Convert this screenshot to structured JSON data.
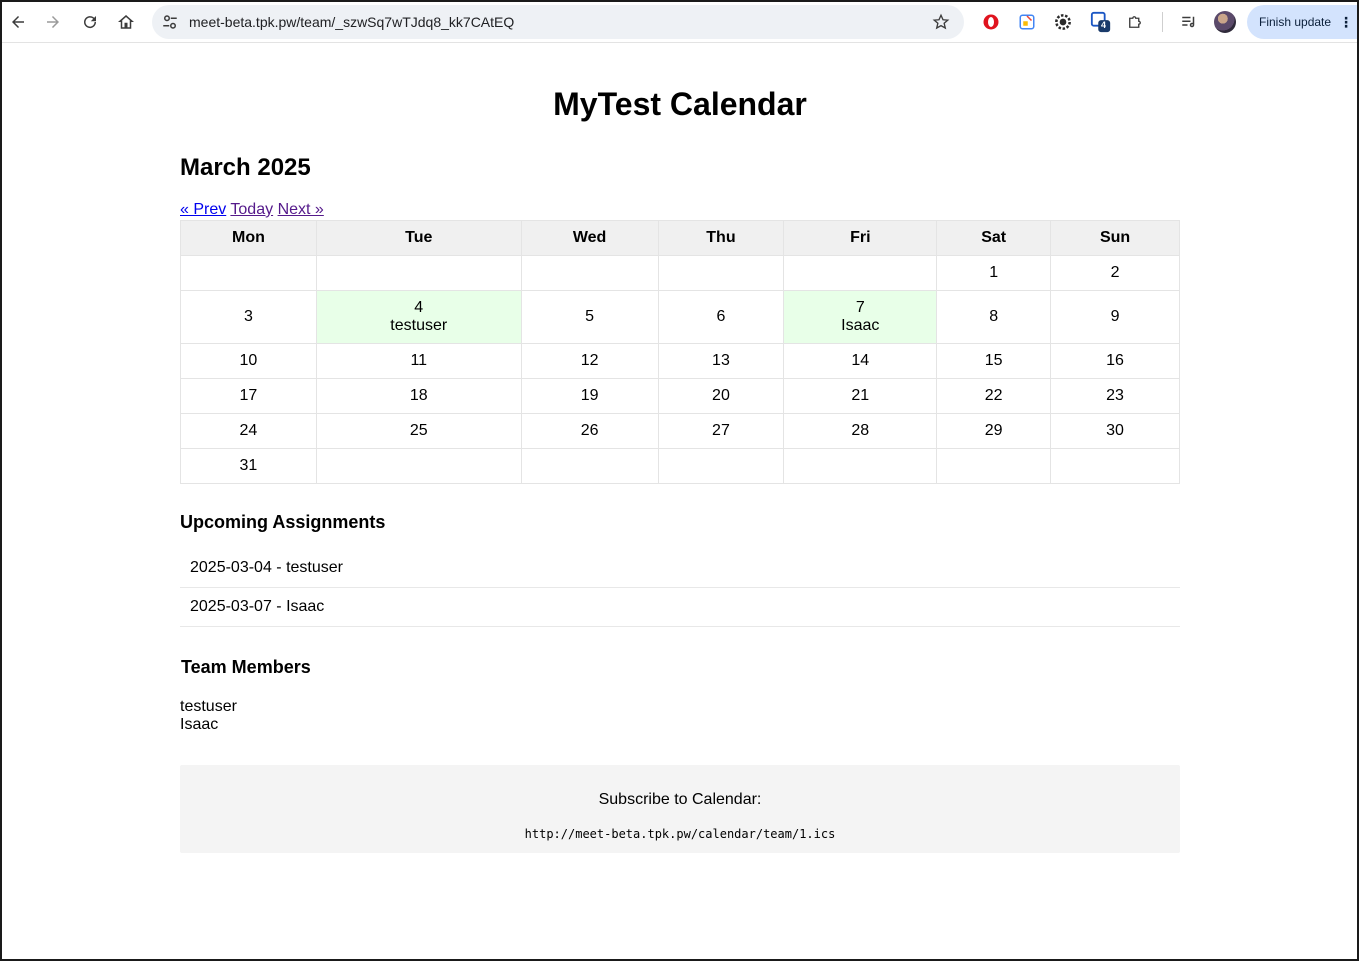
{
  "browser": {
    "url": "meet-beta.tpk.pw/team/_szwSq7wTJdq8_kk7CAtEQ",
    "finish_update_label": "Finish update",
    "extension_badge": "4"
  },
  "page": {
    "title": "MyTest Calendar",
    "month_title": "March 2025",
    "nav": {
      "prev": "« Prev",
      "today": "Today",
      "next": "Next »"
    },
    "weekdays": [
      "Mon",
      "Tue",
      "Wed",
      "Thu",
      "Fri",
      "Sat",
      "Sun"
    ],
    "weeks": [
      [
        {
          "day": ""
        },
        {
          "day": ""
        },
        {
          "day": ""
        },
        {
          "day": ""
        },
        {
          "day": ""
        },
        {
          "day": "1"
        },
        {
          "day": "2"
        }
      ],
      [
        {
          "day": "3"
        },
        {
          "day": "4",
          "user": "testuser"
        },
        {
          "day": "5"
        },
        {
          "day": "6"
        },
        {
          "day": "7",
          "user": "Isaac"
        },
        {
          "day": "8"
        },
        {
          "day": "9"
        }
      ],
      [
        {
          "day": "10"
        },
        {
          "day": "11"
        },
        {
          "day": "12"
        },
        {
          "day": "13"
        },
        {
          "day": "14"
        },
        {
          "day": "15"
        },
        {
          "day": "16"
        }
      ],
      [
        {
          "day": "17"
        },
        {
          "day": "18"
        },
        {
          "day": "19"
        },
        {
          "day": "20"
        },
        {
          "day": "21"
        },
        {
          "day": "22"
        },
        {
          "day": "23"
        }
      ],
      [
        {
          "day": "24"
        },
        {
          "day": "25"
        },
        {
          "day": "26"
        },
        {
          "day": "27"
        },
        {
          "day": "28"
        },
        {
          "day": "29"
        },
        {
          "day": "30"
        }
      ],
      [
        {
          "day": "31"
        },
        {
          "day": ""
        },
        {
          "day": ""
        },
        {
          "day": ""
        },
        {
          "day": ""
        },
        {
          "day": ""
        },
        {
          "day": ""
        }
      ]
    ],
    "upcoming_title": "Upcoming Assignments",
    "assignments": [
      "2025-03-04 - testuser",
      "2025-03-07 - Isaac"
    ],
    "members_title": "Team Members",
    "members": [
      "testuser",
      "Isaac"
    ],
    "subscribe": {
      "label": "Subscribe to Calendar:",
      "ics_url": "http://meet-beta.tpk.pw/calendar/team/1.ics"
    }
  },
  "colors": {
    "assigned_cell": "#e8ffe8",
    "header_row": "#f0f0f0",
    "link": "#0000ee",
    "visited_link": "#551a8b",
    "subscribe_bg": "#f4f4f4",
    "finish_update_bg": "#d3e3fd"
  }
}
